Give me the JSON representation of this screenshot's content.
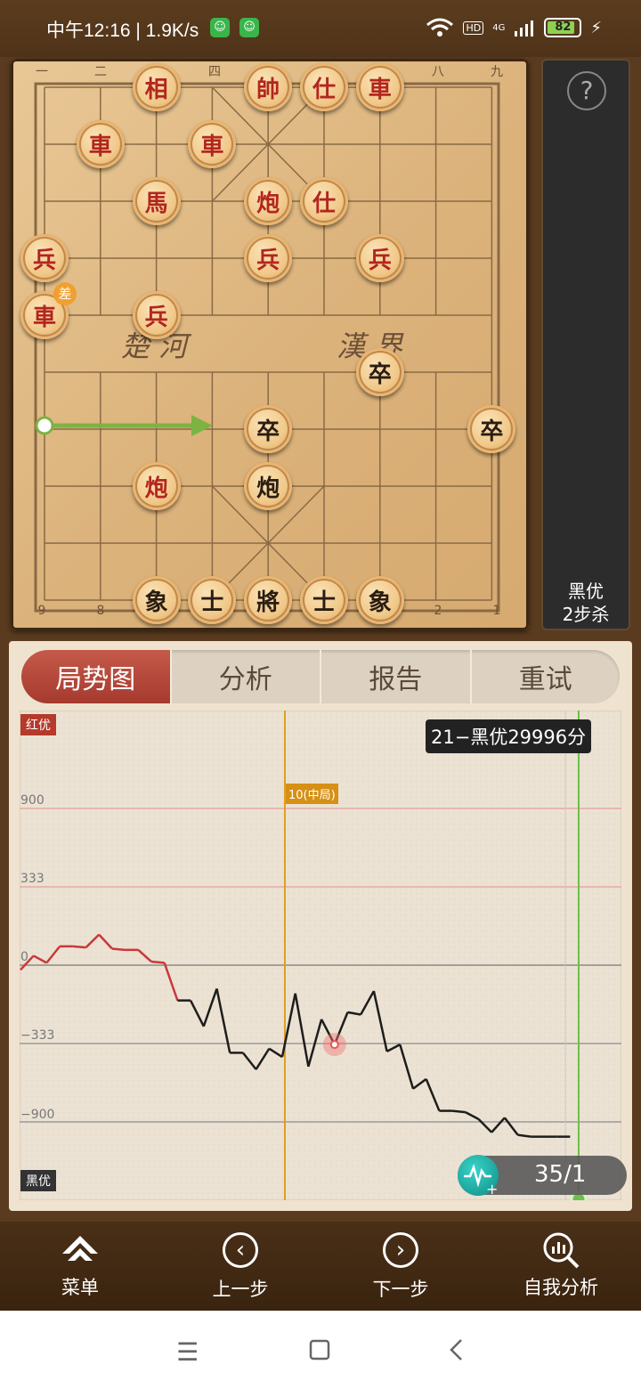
{
  "status_bar": {
    "time": "中午12:16 | 1.9K/s",
    "hd": "HD",
    "network": "4G",
    "battery": "82"
  },
  "board": {
    "file_labels_top": [
      "一",
      "二",
      "",
      "四",
      "",
      "",
      "",
      "八",
      "九"
    ],
    "file_labels_bottom": [
      "9",
      "8",
      "",
      "",
      "",
      "",
      "",
      "2",
      "1"
    ],
    "river_left": "楚 河",
    "river_right": "漢 界",
    "badge": "差",
    "pieces": [
      {
        "ch": "相",
        "side": "red",
        "col": 2,
        "row": 0
      },
      {
        "ch": "帥",
        "side": "red",
        "col": 4,
        "row": 0
      },
      {
        "ch": "仕",
        "side": "red",
        "col": 5,
        "row": 0
      },
      {
        "ch": "車",
        "side": "red",
        "col": 6,
        "row": 0
      },
      {
        "ch": "車",
        "side": "red",
        "col": 1,
        "row": 1
      },
      {
        "ch": "車",
        "side": "red",
        "col": 3,
        "row": 1
      },
      {
        "ch": "馬",
        "side": "red",
        "col": 2,
        "row": 2
      },
      {
        "ch": "炮",
        "side": "red",
        "col": 4,
        "row": 2
      },
      {
        "ch": "仕",
        "side": "red",
        "col": 5,
        "row": 2
      },
      {
        "ch": "兵",
        "side": "red",
        "col": 0,
        "row": 3
      },
      {
        "ch": "兵",
        "side": "red",
        "col": 4,
        "row": 3
      },
      {
        "ch": "兵",
        "side": "red",
        "col": 6,
        "row": 3
      },
      {
        "ch": "車",
        "side": "red",
        "col": 0,
        "row": 4
      },
      {
        "ch": "兵",
        "side": "red",
        "col": 2,
        "row": 4
      },
      {
        "ch": "卒",
        "side": "black",
        "col": 6,
        "row": 5
      },
      {
        "ch": "卒",
        "side": "black",
        "col": 4,
        "row": 6
      },
      {
        "ch": "卒",
        "side": "black",
        "col": 8,
        "row": 6
      },
      {
        "ch": "炮",
        "side": "red",
        "col": 2,
        "row": 7
      },
      {
        "ch": "炮",
        "side": "black",
        "col": 4,
        "row": 7
      },
      {
        "ch": "象",
        "side": "black",
        "col": 2,
        "row": 9
      },
      {
        "ch": "士",
        "side": "black",
        "col": 3,
        "row": 9
      },
      {
        "ch": "將",
        "side": "black",
        "col": 4,
        "row": 9
      },
      {
        "ch": "士",
        "side": "black",
        "col": 5,
        "row": 9
      },
      {
        "ch": "象",
        "side": "black",
        "col": 6,
        "row": 9
      }
    ],
    "hint_color": "#7cb342"
  },
  "side_panel": {
    "help": "?",
    "result_line1": "黑优",
    "result_line2": "2步杀"
  },
  "analysis": {
    "tabs": [
      "局势图",
      "分析",
      "报告",
      "重试"
    ],
    "active_tab": 0,
    "red_adv_label": "红优",
    "black_adv_label": "黑优",
    "tooltip": "21−黑优29996分",
    "midgame_label": "10(中局)",
    "yticks": [
      "900",
      "333",
      "0",
      "−333",
      "−900"
    ],
    "progress": "35/1"
  },
  "chart_data": {
    "type": "line",
    "ylim": [
      -1800,
      1800
    ],
    "y_ticks": [
      900,
      333,
      0,
      -333,
      -900
    ],
    "x": [
      0,
      1,
      2,
      3,
      4,
      5,
      6,
      7,
      8,
      9,
      10,
      11,
      12,
      13,
      14,
      15,
      16,
      17,
      18,
      19,
      20,
      21,
      22,
      23,
      24,
      25,
      26,
      27,
      28,
      29,
      30,
      31,
      32,
      33,
      34,
      35,
      36,
      37,
      38,
      39,
      40,
      41,
      42
    ],
    "values": [
      -20,
      40,
      10,
      80,
      80,
      75,
      130,
      70,
      65,
      65,
      15,
      10,
      -150,
      -150,
      -260,
      -100,
      -400,
      -400,
      -520,
      -370,
      -430,
      -120,
      -500,
      -230,
      -340,
      -200,
      -210,
      -110,
      -390,
      -340,
      -660,
      -590,
      -820,
      -820,
      -830,
      -880,
      -1020,
      -870,
      -1050,
      -1070,
      -1070,
      -1070,
      -1070
    ],
    "highlight_x": 24,
    "midgame_x": 10,
    "current_x": 35
  },
  "bottom_bar": {
    "menu": "菜单",
    "prev": "上一步",
    "next": "下一步",
    "self_analysis": "自我分析"
  }
}
